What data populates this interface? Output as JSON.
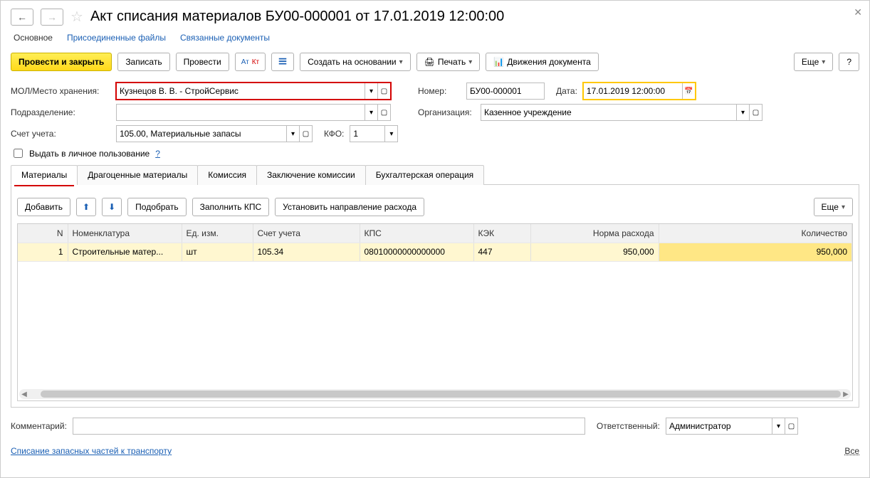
{
  "title": "Акт списания материалов БУ00-000001 от 17.01.2019 12:00:00",
  "topnav": {
    "main": "Основное",
    "files": "Присоединенные файлы",
    "related": "Связанные документы"
  },
  "toolbar": {
    "post_close": "Провести и закрыть",
    "save": "Записать",
    "post": "Провести",
    "create_based": "Создать на основании",
    "print": "Печать",
    "movements": "Движения документа",
    "more": "Еще",
    "help": "?"
  },
  "fields": {
    "mol_label": "МОЛ/Место хранения:",
    "mol_value": "Кузнецов В. В. - СтройСервис",
    "number_label": "Номер:",
    "number_value": "БУ00-000001",
    "date_label": "Дата:",
    "date_value": "17.01.2019 12:00:00",
    "dept_label": "Подразделение:",
    "dept_value": "",
    "org_label": "Организация:",
    "org_value": "Казенное учреждение",
    "account_label": "Счет учета:",
    "account_value": "105.00, Материальные запасы",
    "kfo_label": "КФО:",
    "kfo_value": "1",
    "personal_use": "Выдать в личное пользование",
    "help_q": "?"
  },
  "tabs": {
    "materials": "Материалы",
    "precious": "Драгоценные материалы",
    "commission": "Комиссия",
    "conclusion": "Заключение комиссии",
    "bookkeeping": "Бухгалтерская операция"
  },
  "tabtoolbar": {
    "add": "Добавить",
    "pick": "Подобрать",
    "fill_kps": "Заполнить КПС",
    "set_expense_dir": "Установить направление расхода",
    "more": "Еще"
  },
  "table": {
    "headers": {
      "n": "N",
      "nomen": "Номенклатура",
      "unit": "Ед. изм.",
      "account": "Счет учета",
      "kps": "КПС",
      "kek": "КЭК",
      "norm": "Норма расхода",
      "qty": "Количество"
    },
    "rows": [
      {
        "n": "1",
        "nomen": "Строительные матер...",
        "unit": "шт",
        "account": "105.34",
        "kps": "08010000000000000",
        "kek": "447",
        "norm": "950,000",
        "qty": "950,000"
      }
    ]
  },
  "footer": {
    "comment_label": "Комментарий:",
    "comment_value": "",
    "responsible_label": "Ответственный:",
    "responsible_value": "Администратор"
  },
  "bottom_link": "Списание запасных частей к транспорту",
  "all_link": "Все"
}
